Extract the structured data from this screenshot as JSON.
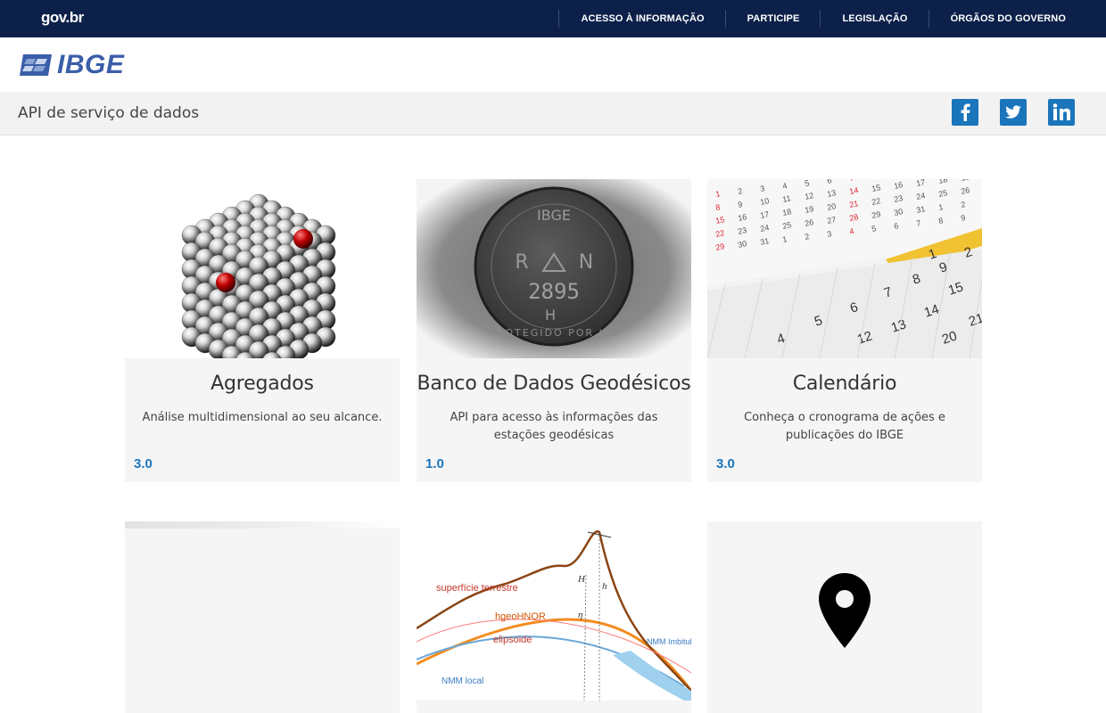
{
  "govbar": {
    "logo": "gov.br",
    "nav": [
      "ACESSO À INFORMAÇÃO",
      "PARTICIPE",
      "LEGISLAÇÃO",
      "ÓRGÃOS DO GOVERNO"
    ]
  },
  "brand": {
    "name": "IBGE",
    "color": "#3a5ea9"
  },
  "subbar": {
    "title": "API de serviço de dados",
    "social": [
      "facebook-icon",
      "twitter-icon",
      "linkedin-icon"
    ]
  },
  "cards": [
    {
      "title": "Agregados",
      "description": "Análise multidimensional ao seu alcance.",
      "version": "3.0",
      "image": "metal-spheres-cube"
    },
    {
      "title": "Banco de Dados Geodésicos",
      "description": "API para acesso às informações das estações geodésicas",
      "version": "1.0",
      "image": "geodetic-marker-plate",
      "image_text": [
        "IBGE",
        "R",
        "N",
        "2895",
        "H",
        "PROTEGIDO POR LEI"
      ]
    },
    {
      "title": "Calendário",
      "description": "Conheça o cronograma de ações e publicações do IBGE",
      "version": "3.0",
      "image": "calendar-pages"
    },
    {
      "image": "blank"
    },
    {
      "image": "geoid-diagram",
      "image_text": [
        "superfície terrestre",
        "hgeoHNOR",
        "elipsoide",
        "NMM local",
        "NMM Imbituba e Santana",
        "H",
        "h",
        "η"
      ]
    },
    {
      "image": "map-marker-icon"
    }
  ],
  "colors": {
    "govbar": "#0c2049",
    "accent": "#1b75bb",
    "card_bg": "#f5f5f5"
  }
}
